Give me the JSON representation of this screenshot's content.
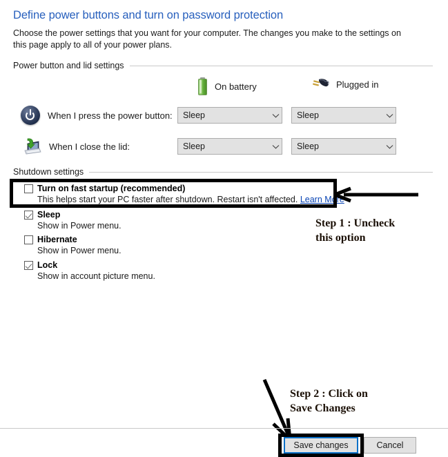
{
  "header": {
    "title": "Define power buttons and turn on password protection",
    "description": "Choose the power settings that you want for your computer. The changes you make to the settings on this page apply to all of your power plans."
  },
  "groups": {
    "power_lid": {
      "label": "Power button and lid settings"
    },
    "shutdown": {
      "label": "Shutdown settings"
    }
  },
  "columns": [
    {
      "icon": "battery-icon",
      "label": "On battery"
    },
    {
      "icon": "power-plug-icon",
      "label": "Plugged in"
    }
  ],
  "settings_rows": [
    {
      "icon": "power-button-icon",
      "label": "When I press the power button:",
      "on_battery": "Sleep",
      "plugged_in": "Sleep"
    },
    {
      "icon": "laptop-lid-icon",
      "label": "When I close the lid:",
      "on_battery": "Sleep",
      "plugged_in": "Sleep"
    }
  ],
  "shutdown_options": [
    {
      "name": "fast-startup",
      "title": "Turn on fast startup (recommended)",
      "checked": false,
      "sub_text": "This helps start your PC faster after shutdown. Restart isn't affected. ",
      "link_text": "Learn More"
    },
    {
      "name": "sleep",
      "title": "Sleep",
      "checked": true,
      "sub_text": "Show in Power menu.",
      "link_text": ""
    },
    {
      "name": "hibernate",
      "title": "Hibernate",
      "checked": false,
      "sub_text": "Show in Power menu.",
      "link_text": ""
    },
    {
      "name": "lock",
      "title": "Lock",
      "checked": true,
      "sub_text": "Show in account picture menu.",
      "link_text": ""
    }
  ],
  "annotations": [
    {
      "name": "step-1",
      "text": "Step 1 : Uncheck\nthis option"
    },
    {
      "name": "step-2",
      "text": "Step 2 : Click on\nSave Changes"
    }
  ],
  "footer": {
    "save_label": "Save changes",
    "cancel_label": "Cancel"
  },
  "colors": {
    "title_blue": "#2860bd",
    "link_blue": "#0a45b5",
    "focus_blue": "#0a70c8",
    "annotation_black": "#000000",
    "control_face": "#e2e2e2",
    "control_border": "#acacac",
    "separator": "#c8c8c8",
    "battery_green": "#5faa37"
  }
}
